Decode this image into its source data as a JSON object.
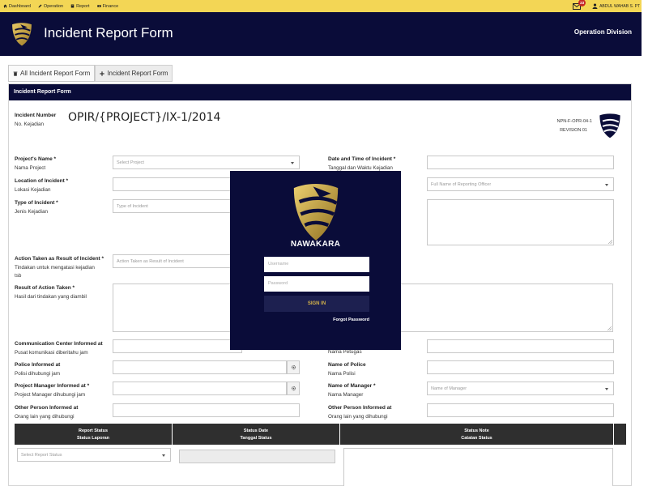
{
  "topbar": {
    "nav": [
      {
        "label": "Dashboard",
        "icon": "home-icon"
      },
      {
        "label": "Operation",
        "icon": "pencil-icon"
      },
      {
        "label": "Report",
        "icon": "book-icon"
      },
      {
        "label": "Finance",
        "icon": "money-icon"
      }
    ],
    "notification_count": "23",
    "user_name": "ABDUL WAHAB S. PT"
  },
  "header": {
    "title": "Incident Report Form",
    "division": "Operation Division"
  },
  "tabs": [
    {
      "label": "All Incident Report Form",
      "icon": "trash-icon"
    },
    {
      "label": "Incident Report Form",
      "icon": "plus-icon"
    }
  ],
  "panel": {
    "title": "Incident Report Form",
    "incident_number_label": "Incident Number",
    "incident_number_sub": "No. Kejadian",
    "incident_number_value": "OPIR/{PROJECT}/IX-1/2014",
    "doc_code": "NPN-F-OPR-04-1",
    "revision": "REVISION 01"
  },
  "form": {
    "project_name": {
      "label": "Project's Name",
      "sub": "Nama Project",
      "placeholder": "Select Project"
    },
    "location": {
      "label": "Location of Incident",
      "sub": "Lokasi Kejadian"
    },
    "type": {
      "label": "Type of Incident",
      "sub": "Jenis Kejadian",
      "placeholder": "Type of Incident"
    },
    "action_taken": {
      "label": "Action Taken as Result of Incident",
      "sub1": "Tindakan untuk mengatasi kejadian",
      "sub2": "tsb",
      "placeholder": "Action Taken as Result of Incident"
    },
    "result_action": {
      "label": "Result of Action Taken",
      "sub": "Hasil dari tindakan yang diambil"
    },
    "date_time": {
      "label": "Date and Time of Incident",
      "sub": "Tanggal dan Waktu Kejadian"
    },
    "reporting_officer": {
      "placeholder": "Full Name of Reporting Officer"
    },
    "comm_center": {
      "label": "Communication Center Informed at",
      "sub": "Pusat komunikasi diberitahu jam"
    },
    "officer_name_sub": "Nama Petugas",
    "police_informed": {
      "label": "Police Informed at",
      "sub": "Polisi dihubungi jam"
    },
    "police_name": {
      "label": "Name of Police",
      "sub": "Nama Polisi"
    },
    "pm_informed": {
      "label": "Project Manager Informed at",
      "sub": "Project Manager dihubungi jam"
    },
    "manager_name": {
      "label": "Name of Manager",
      "sub": "Nama Manager",
      "placeholder": "Name of Manager"
    },
    "other_person_left": {
      "label": "Other Person Informed at",
      "sub": "Orang lain yang dihubungi"
    },
    "other_person_right": {
      "label": "Other Person Informed at",
      "sub": "Orang lain yang dihubungi"
    },
    "status_table": {
      "col1": {
        "title": "Report Status",
        "sub": "Status Laporan"
      },
      "col2": {
        "title": "Status Date",
        "sub": "Tanggal Status"
      },
      "col3": {
        "title": "Status Note",
        "sub": "Catatan Status"
      },
      "report_status_placeholder": "Select Report Status"
    }
  },
  "login": {
    "brand": "NAWAKARA",
    "username_placeholder": "Username",
    "password_placeholder": "Password",
    "sign_in": "SIGN IN",
    "forgot": "Forgot Password"
  },
  "colors": {
    "navy": "#0a0c39",
    "topbar_yellow": "#f3d655",
    "gold": "#c9a43d",
    "table_header": "#2f2f2f"
  }
}
